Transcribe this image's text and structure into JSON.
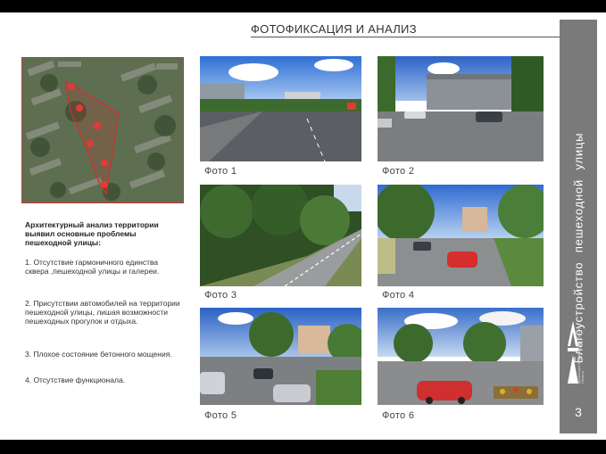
{
  "title": "ФОТОФИКСАЦИЯ И АНАЛИЗ",
  "side_title": "Благоустройство пешеходной улицы",
  "page_number": "3",
  "logo": {
    "letters": "AIV",
    "text": "Архитектура Инфраструктура Проекты Области"
  },
  "analysis": {
    "heading": "Архитектурный анализ территории выявил основные проблемы пешеходной улицы:",
    "items": [
      "1. Отсутствие гармоничного единства сквера ,пешеходной улицы и галереи.",
      "2. Присутствии автомобилей на территории пешеходной улицы, лишая возможности пешеходных прогулок и отдыха.",
      "3. Плохое состояние бетонного мощения.",
      "4. Отсутствие функционала."
    ]
  },
  "photos": [
    {
      "caption": "Фото 1"
    },
    {
      "caption": "Фото 2"
    },
    {
      "caption": "Фото 3"
    },
    {
      "caption": "Фото 4"
    },
    {
      "caption": "Фото 5"
    },
    {
      "caption": "Фото 6"
    }
  ],
  "colors": {
    "sidebar": "#7a7a7a",
    "highlight": "#d32f2f",
    "title_line": "#555555"
  }
}
